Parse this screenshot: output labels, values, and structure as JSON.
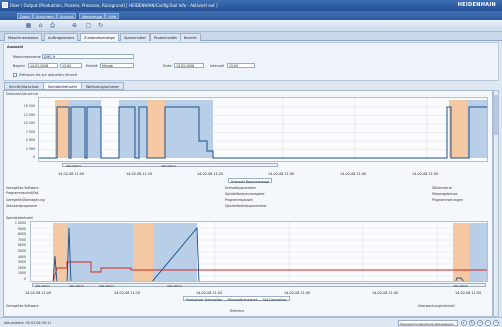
{
  "window": {
    "title": "Fiber / Output (Produktion, Prozess, Prozesse, Rückgrund)   [ HEIDENHAIN/Config-Tool Info - Aktiviert ext ]",
    "brand": "HEIDENHAIN"
  },
  "menu": [
    "Datei",
    "Ansichten",
    "Ansicht",
    "Werkzeuge",
    "Hilfe"
  ],
  "toolbar": [
    "calendar-icon",
    "home-icon",
    "print-icon",
    "zoom-icon",
    "window-icon",
    "refresh-icon"
  ],
  "tabs": [
    {
      "label": "Maschinenstatus",
      "active": false
    },
    {
      "label": "Auftragsstatus",
      "active": false
    },
    {
      "label": "Zustandsanzeige",
      "active": true
    },
    {
      "label": "Spannmittel",
      "active": false
    },
    {
      "label": "Produktivität",
      "active": false
    },
    {
      "label": "Bericht",
      "active": false
    }
  ],
  "filter": {
    "title": "Auswahl",
    "machine_label": "Maschinenname",
    "machine_value": "DMG Fr",
    "start_label": "Beginn",
    "start_date": "14.02.2008",
    "start_time": "12:00",
    "unit_label": "Einheit",
    "unit_value": "Minute",
    "end_label": "Ende",
    "end_date": "14.02.2008",
    "interval_label": "Intervall",
    "interval_value": "15:00",
    "checkbox_label": "Zeitraum bis zur aktuellen Uhrzeit"
  },
  "subtabs": [
    {
      "label": "Schritt/Vorschub",
      "active": false
    },
    {
      "label": "Spindeldrehzahl",
      "active": true
    },
    {
      "label": "Werkzeugnummer",
      "active": false
    }
  ],
  "chart_top": {
    "title": "Drehzahl/Vorschub",
    "y_ticks": [
      "15 000",
      "12 500",
      "10 000",
      "7 500",
      "5 000",
      "2 500",
      "0"
    ],
    "x_ticks": [
      "14-02-08 11:00",
      "14-02-08 11:10",
      "14-02-08 11:20",
      "14-02-08 11:30",
      "14-02-08 11:40",
      "14-02-08 11:50"
    ],
    "nav_items": [
      "999-00024",
      "999-00024"
    ],
    "legend": "Drehzahl Maschinenkopf"
  },
  "info": {
    "left": [
      "Geregeltes Software",
      "Programmaufruf/Fall",
      "Geregelte/Überlagerung",
      "Standardprogramm"
    ],
    "mid": [
      "Drehzahlparameter",
      "Spindelfrequenzausgabe",
      "Programmpausen",
      "Spindelbetriebsparameter"
    ],
    "right": [
      "Zählervorrat",
      "Messergebnisse",
      "Programmierungen"
    ]
  },
  "chart_bottom": {
    "title": "Spindeldrehzahl",
    "y_ticks": [
      "1 0000",
      "9000",
      "8000",
      "7000",
      "6000",
      "5000",
      "4000",
      "3000",
      "2000",
      "1000",
      "0"
    ],
    "x_ticks": [
      "14-02-08 11:00",
      "14-02-08 11:10",
      "14-02-08 11:20",
      "14-02-08 11:30",
      "14-02-08 11:40",
      "14-02-08 11:50"
    ],
    "nav_items": [
      "999-00024",
      "999-00024",
      "999-00024",
      "999-00024",
      "999-00024"
    ],
    "legend": "Produktiver Drehzahlen  — Maximaldrehzahlen  — Soll-Drehzahlen"
  },
  "footer": {
    "left_label": "Geregeltes Software",
    "ref_label": "Referenz",
    "right_label": "Überwachungsintervall",
    "status": "Aktualisiert: 05.03.06 09:11",
    "status_select": "Überwachungsinterval aktualisieren"
  },
  "colors": {
    "running": "#b9cfe8",
    "setup": "#f4c8a2",
    "speed_line": "#1c4f8c",
    "red_line": "#d62323",
    "accent": "#2e5d9f"
  }
}
